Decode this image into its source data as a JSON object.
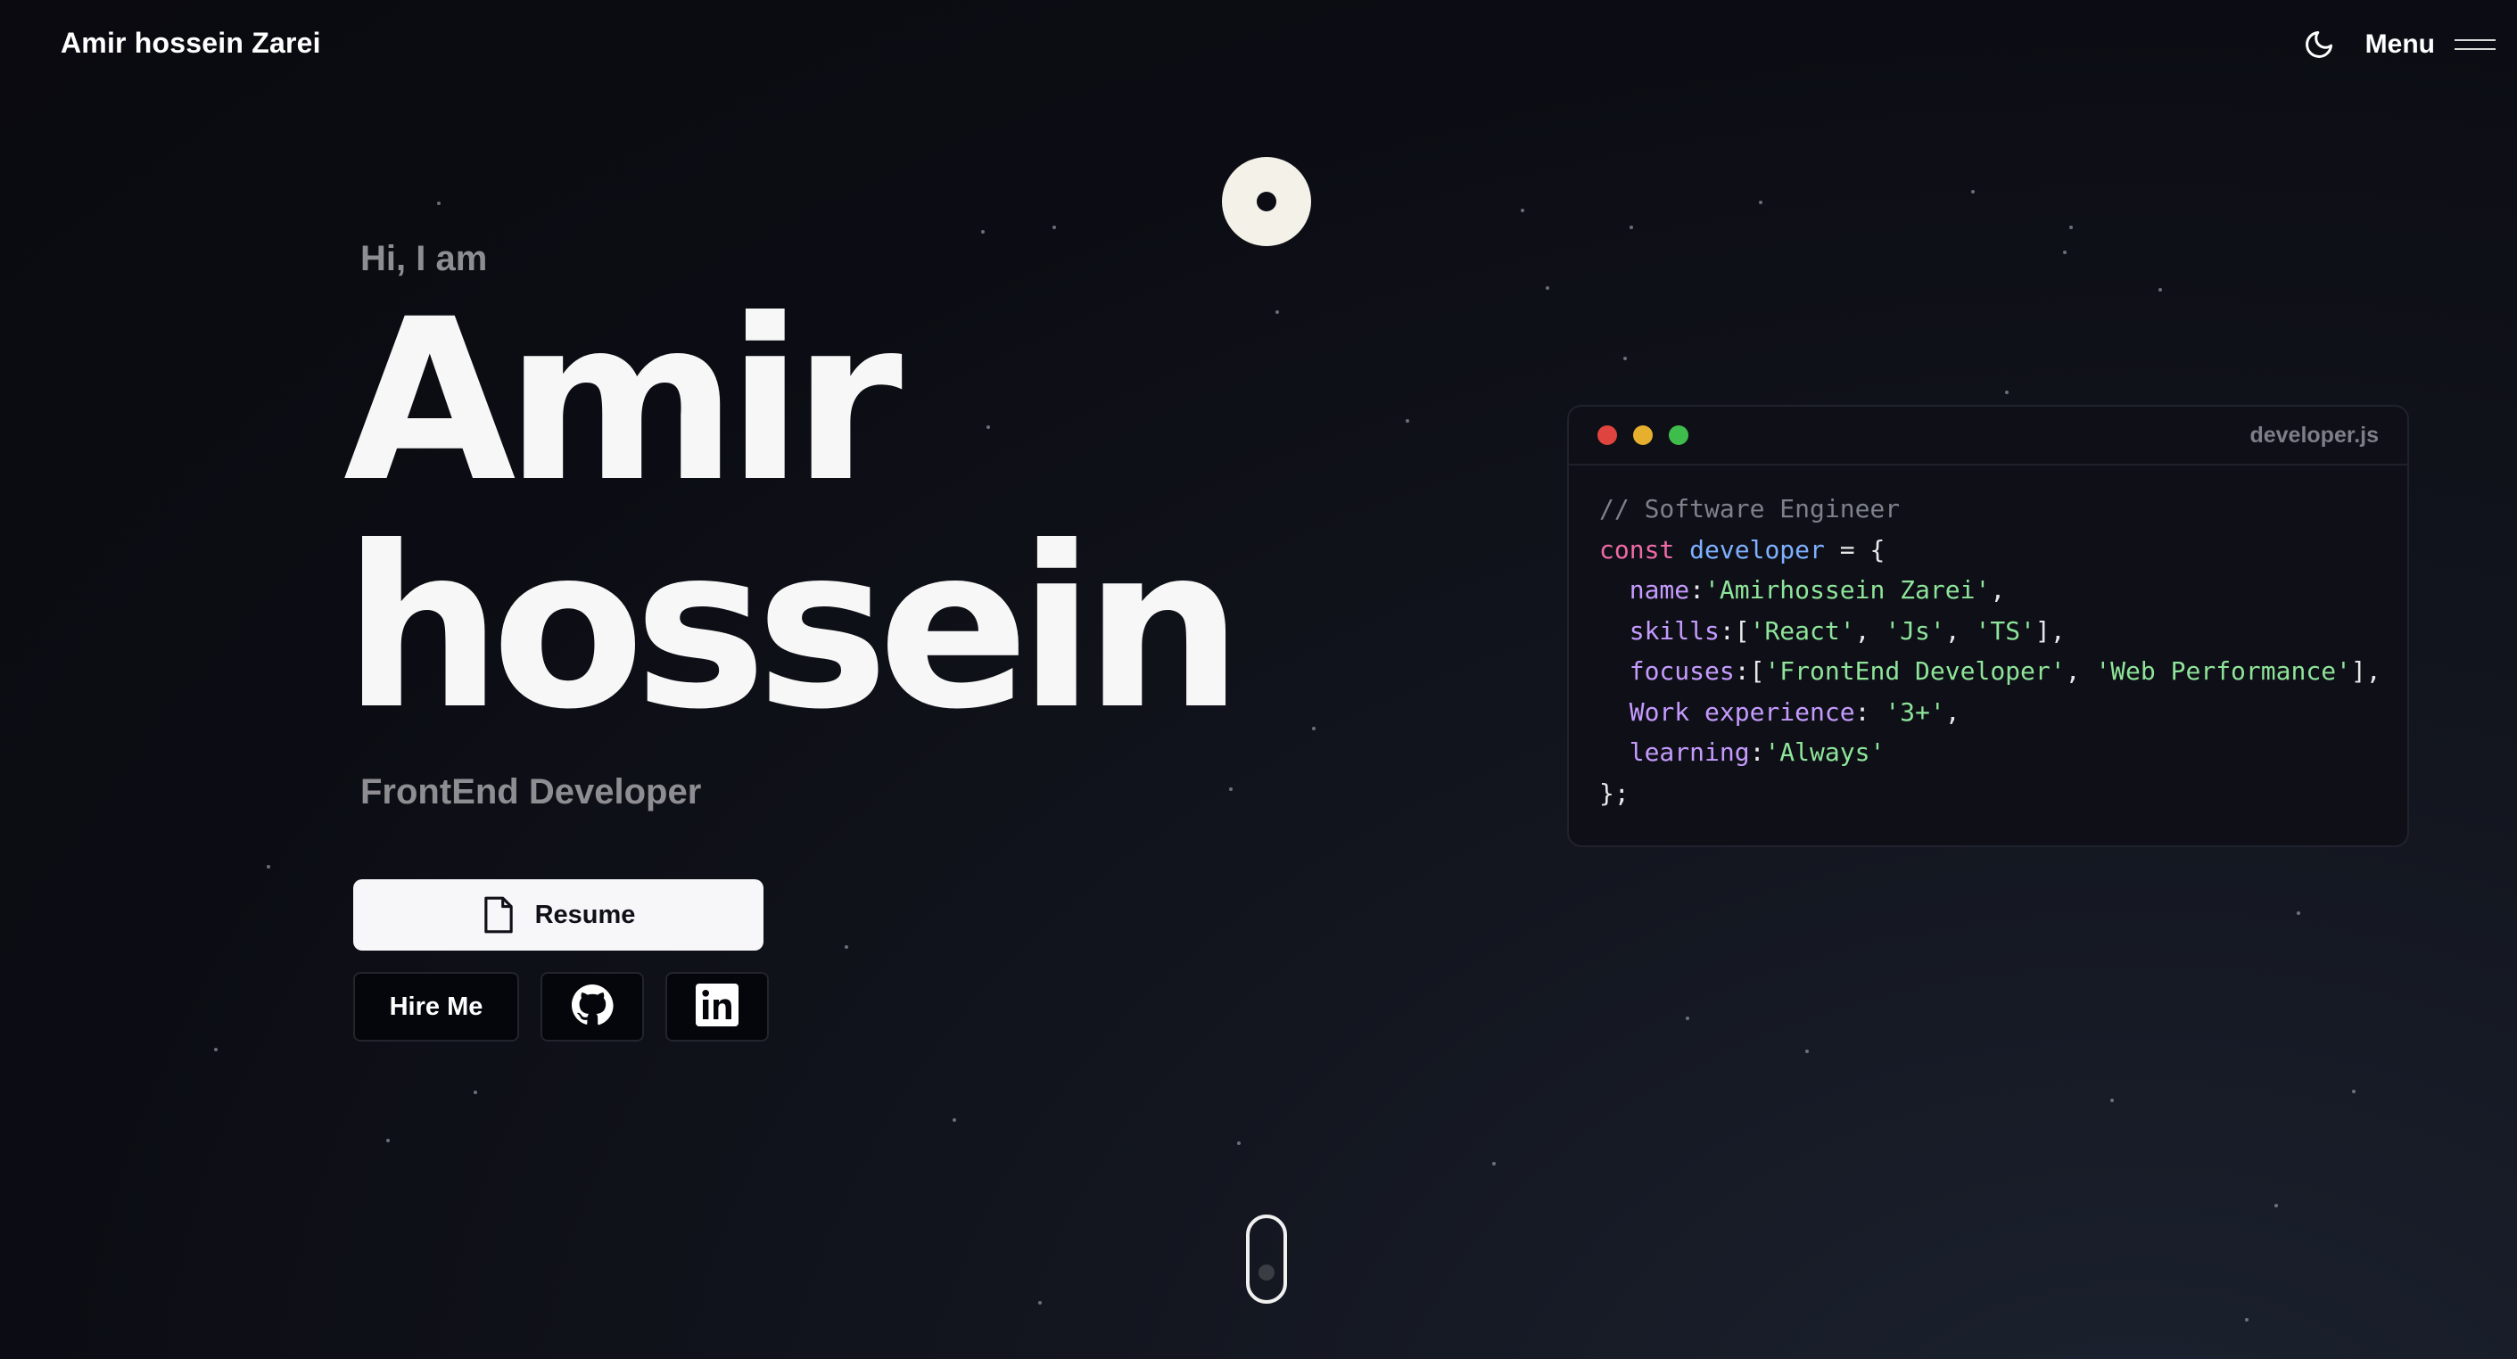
{
  "header": {
    "brand": "Amir hossein Zarei",
    "theme_icon": "moon-icon",
    "menu_label": "Menu",
    "menu_icon": "hamburger-icon"
  },
  "hero": {
    "greeting": "Hi, I am",
    "name_line1": "Amir",
    "name_line2": "hossein",
    "role": "FrontEnd Developer"
  },
  "actions": {
    "resume_label": "Resume",
    "resume_icon": "document-icon",
    "hire_label": "Hire Me",
    "github_icon": "github-icon",
    "linkedin_icon": "linkedin-icon"
  },
  "code_window": {
    "filename": "developer.js",
    "dots": [
      "#e0443e",
      "#e6b02e",
      "#3fbd4c"
    ],
    "comment": "// Software Engineer",
    "kw_const": "const",
    "var_name": "developer",
    "op_open": " = {",
    "k_name": "name",
    "v_name": "'Amirhossein Zarei'",
    "k_skills": "skills",
    "v_skills": [
      "'React'",
      "'Js'",
      "'TS'"
    ],
    "k_focuses": "focuses",
    "v_focuses": [
      "'FrontEnd Developer'",
      "'Web Performance'"
    ],
    "k_work": "Work experience",
    "v_work": "'3+'",
    "k_learning": "learning",
    "v_learning": "'Always'",
    "close": "};"
  },
  "colors": {
    "background": "#0c0d14",
    "accent_text": "#f7f7f7",
    "muted_text": "#8d8d92"
  }
}
